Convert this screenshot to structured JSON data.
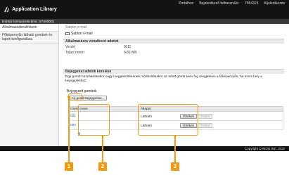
{
  "header": {
    "app_title": "Application Library",
    "links": [
      "Portálhoz",
      "Bejelentkező felhasználó:",
      "7654321",
      "Kijelentkezés"
    ]
  },
  "device_bar": "Eszköz környezetszáma: SYS00001",
  "sidebar": {
    "items": [
      {
        "label": "Alkalmazásbeállítások"
      },
      {
        "label": "Főképernyőn látható gombok és lapok konfigurálása"
      }
    ]
  },
  "main": {
    "breadcrumb": "Sablon e-mail",
    "app_name": "Sablon e-mail",
    "info_header": "Alkalmazásra vonatkozó adatok",
    "info_rows": [
      {
        "key": "Verzió",
        "value": "0111"
      },
      {
        "key": "Teljes méret",
        "value": "6.81 MB"
      }
    ],
    "button_header": "Bejegyzési adatok kezelése",
    "description": "Egy gomb hozzáadásakor vagy megjelenítésének módosításakor az adott gomb nem fog megjelenni a főképernyőn, ha nincs hely a bejegyzéshez.",
    "registered_label": "Bejegyzett gombok",
    "add_button": "Új gomb bejegyzése...",
    "table": {
      "col1": "Gomb neve",
      "col2": "Állapot",
      "rows": [
        {
          "name": "001",
          "status": "Látható",
          "edit": "Értékek",
          "delete": "Törlés"
        },
        {
          "name": "002",
          "status": "Látható",
          "edit": "Értékek",
          "delete": "Törlés"
        }
      ]
    }
  },
  "footer": "Copyright CANON INC. 2022",
  "callouts": [
    "1",
    "2",
    "3"
  ],
  "colors": {
    "accent": "#f09a0f",
    "topbar": "#141414",
    "link": "#1a57b0"
  }
}
